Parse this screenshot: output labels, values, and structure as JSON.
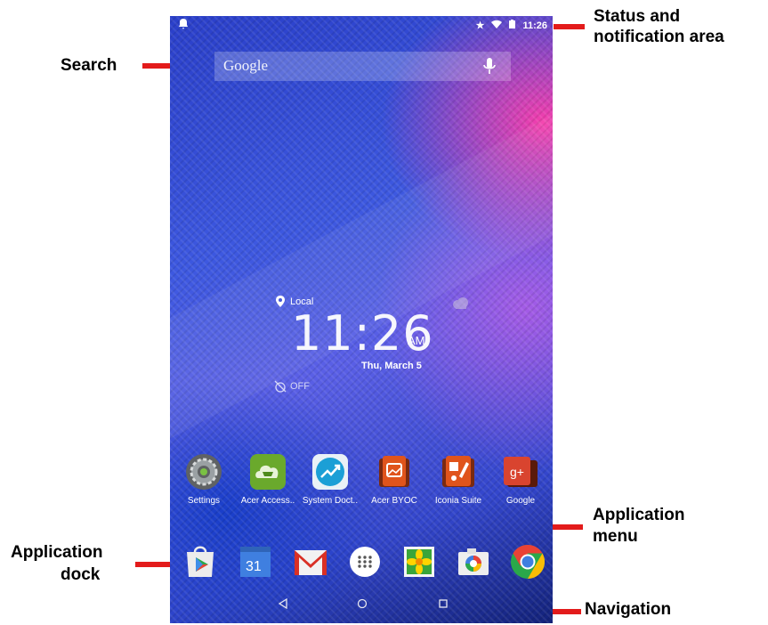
{
  "annotations": {
    "search": "Search",
    "status_line1": "Status and",
    "status_line2": "notification area",
    "app_menu_line1": "Application",
    "app_menu_line2": "menu",
    "app_dock_line1": "Application",
    "app_dock_line2": "dock",
    "navigation": "Navigation"
  },
  "status_bar": {
    "time": "11:26"
  },
  "search": {
    "logo_text": "Google"
  },
  "clock": {
    "location": "Local",
    "time": "11:26",
    "ampm": "AM",
    "date": "Thu, March 5",
    "alarm": "OFF"
  },
  "apps": [
    {
      "label": "Settings",
      "icon": "settings-icon"
    },
    {
      "label": "Acer Access..",
      "icon": "acer-access-icon"
    },
    {
      "label": "System Doct..",
      "icon": "system-doctor-icon"
    },
    {
      "label": "Acer BYOC",
      "icon": "acer-byoc-icon"
    },
    {
      "label": "Iconia Suite",
      "icon": "iconia-suite-icon"
    },
    {
      "label": "Google",
      "icon": "google-folder-icon"
    }
  ],
  "dock": {
    "items": [
      "play-store-icon",
      "calendar-icon",
      "gmail-icon",
      "app-drawer-icon",
      "gallery-icon",
      "camera-icon",
      "chrome-icon"
    ],
    "calendar_day": "31"
  },
  "colors": {
    "annotation_bar": "#e31b1b",
    "accent": "#ffffff"
  }
}
